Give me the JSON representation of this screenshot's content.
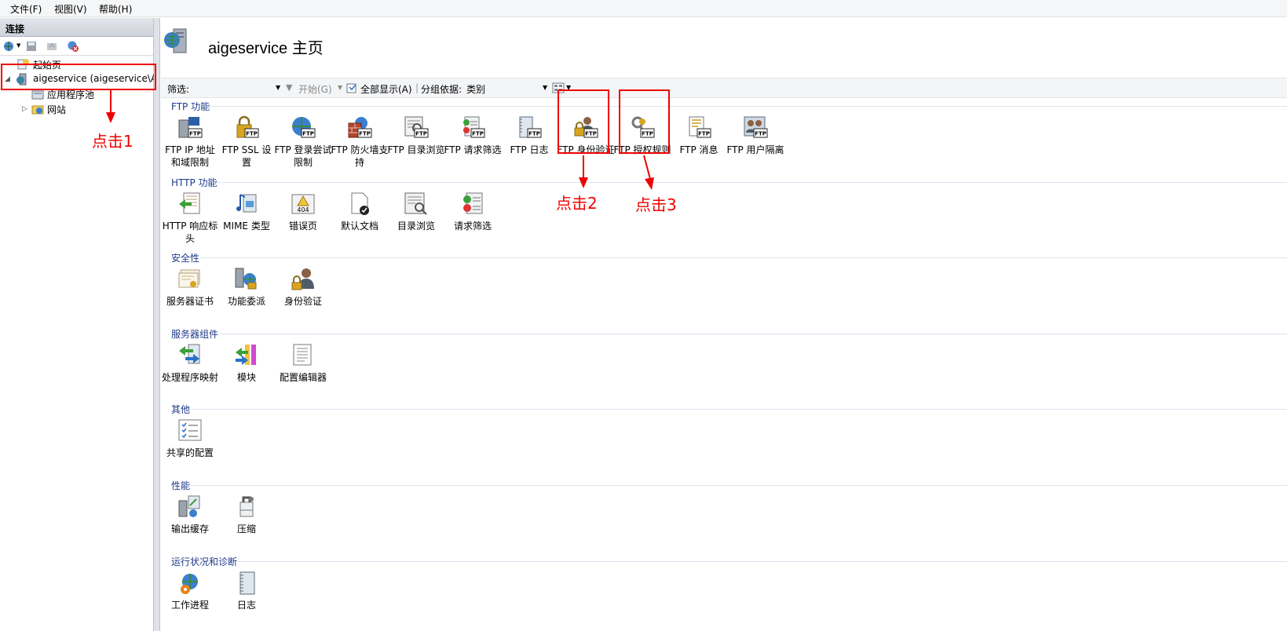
{
  "menu": [
    {
      "label": "文件(F)"
    },
    {
      "label": "视图(V)"
    },
    {
      "label": "帮助(H)"
    }
  ],
  "connections": {
    "header": "连接",
    "tree": [
      {
        "label": "起始页"
      },
      {
        "label": "aigeservice (aigeservice\\A"
      },
      {
        "label": "应用程序池"
      },
      {
        "label": "网站"
      }
    ]
  },
  "main": {
    "title": "aigeservice 主页",
    "filter": {
      "filter_label": "筛选:",
      "start_label": "开始(G)",
      "show_all_label": "全部显示(A)",
      "group_by_label": "分组依据:",
      "group_by_value": "类别"
    },
    "groups": [
      {
        "name": "FTP 功能",
        "items": [
          {
            "label": "FTP IP 地址和域限制",
            "icon": "ftp-ip-icon"
          },
          {
            "label": "FTP SSL 设置",
            "icon": "ftp-ssl-icon"
          },
          {
            "label": "FTP 登录尝试限制",
            "icon": "ftp-logon-icon"
          },
          {
            "label": "FTP 防火墙支持",
            "icon": "ftp-firewall-icon"
          },
          {
            "label": "FTP 目录浏览",
            "icon": "ftp-directory-icon"
          },
          {
            "label": "FTP 请求筛选",
            "icon": "ftp-request-filter-icon"
          },
          {
            "label": "FTP 日志",
            "icon": "ftp-log-icon"
          },
          {
            "label": "FTP 身份验证",
            "icon": "ftp-auth-icon"
          },
          {
            "label": "FTP 授权规则",
            "icon": "ftp-authz-icon"
          },
          {
            "label": "FTP 消息",
            "icon": "ftp-message-icon"
          },
          {
            "label": "FTP 用户隔离",
            "icon": "ftp-user-isolation-icon"
          }
        ]
      },
      {
        "name": "HTTP 功能",
        "items": [
          {
            "label": "HTTP 响应标头",
            "icon": "http-headers-icon"
          },
          {
            "label": "MIME 类型",
            "icon": "mime-icon"
          },
          {
            "label": "错误页",
            "icon": "error-page-icon"
          },
          {
            "label": "默认文档",
            "icon": "default-doc-icon"
          },
          {
            "label": "目录浏览",
            "icon": "directory-icon"
          },
          {
            "label": "请求筛选",
            "icon": "request-filter-icon"
          }
        ]
      },
      {
        "name": "安全性",
        "items": [
          {
            "label": "服务器证书",
            "icon": "certificate-icon"
          },
          {
            "label": "功能委派",
            "icon": "delegation-icon"
          },
          {
            "label": "身份验证",
            "icon": "auth-icon"
          }
        ]
      },
      {
        "name": "服务器组件",
        "items": [
          {
            "label": "处理程序映射",
            "icon": "handler-icon"
          },
          {
            "label": "模块",
            "icon": "modules-icon"
          },
          {
            "label": "配置编辑器",
            "icon": "config-editor-icon"
          }
        ]
      },
      {
        "name": "其他",
        "items": [
          {
            "label": "共享的配置",
            "icon": "shared-config-icon"
          }
        ]
      },
      {
        "name": "性能",
        "items": [
          {
            "label": "输出缓存",
            "icon": "output-cache-icon"
          },
          {
            "label": "压缩",
            "icon": "compression-icon"
          }
        ]
      },
      {
        "name": "运行状况和诊断",
        "items": [
          {
            "label": "工作进程",
            "icon": "worker-process-icon"
          },
          {
            "label": "日志",
            "icon": "log-icon"
          }
        ]
      }
    ]
  },
  "annotations": [
    {
      "label": "点击1"
    },
    {
      "label": "点击2"
    },
    {
      "label": "点击3"
    }
  ],
  "colors": {
    "annotation": "#e00000",
    "group_header": "#1e3a8a"
  }
}
